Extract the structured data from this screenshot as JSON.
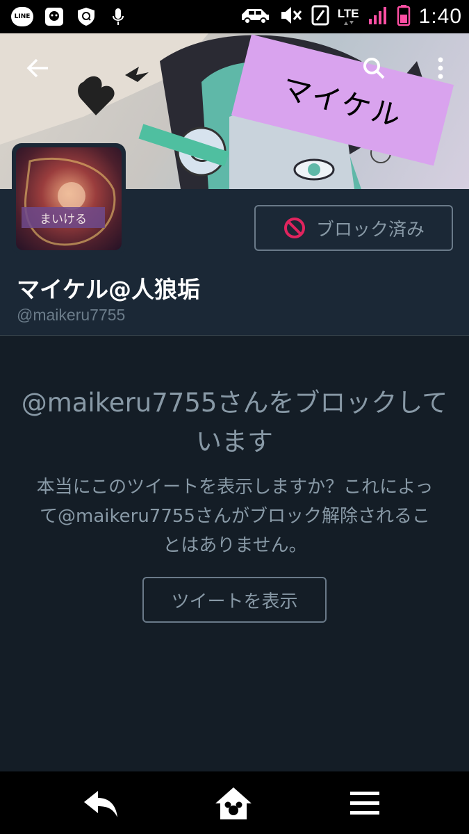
{
  "status_bar": {
    "line_label": "LINE",
    "network": "LTE",
    "time": "1:40",
    "icons": [
      "line-icon",
      "app-icon",
      "security-icon",
      "mic-icon",
      "car-icon",
      "mute-icon",
      "nfc-icon",
      "signal-icon",
      "battery-icon"
    ]
  },
  "header": {
    "banner_text": "マイケル",
    "back_icon": "back-arrow-icon",
    "search_icon": "search-icon",
    "menu_icon": "more-vert-icon"
  },
  "profile": {
    "avatar_text": "まいける",
    "display_name": "マイケル@人狼垢",
    "handle": "@maikeru7755",
    "blocked_label": "ブロック済み"
  },
  "message": {
    "title": "@maikeru7755さんをブロックしています",
    "body": "本当にこのツイートを表示しますか？これによって@maikeru7755さんがブロック解除されることはありません。",
    "view_button": "ツイートを表示"
  },
  "bottom_nav": {
    "items": [
      "back-icon",
      "home-icon",
      "menu-icon"
    ]
  },
  "colors": {
    "background": "#141d26",
    "profile_bg": "#1b2836",
    "muted_text": "#8899a6",
    "block_red": "#e0245e",
    "banner_label": "#d9a3ee"
  }
}
